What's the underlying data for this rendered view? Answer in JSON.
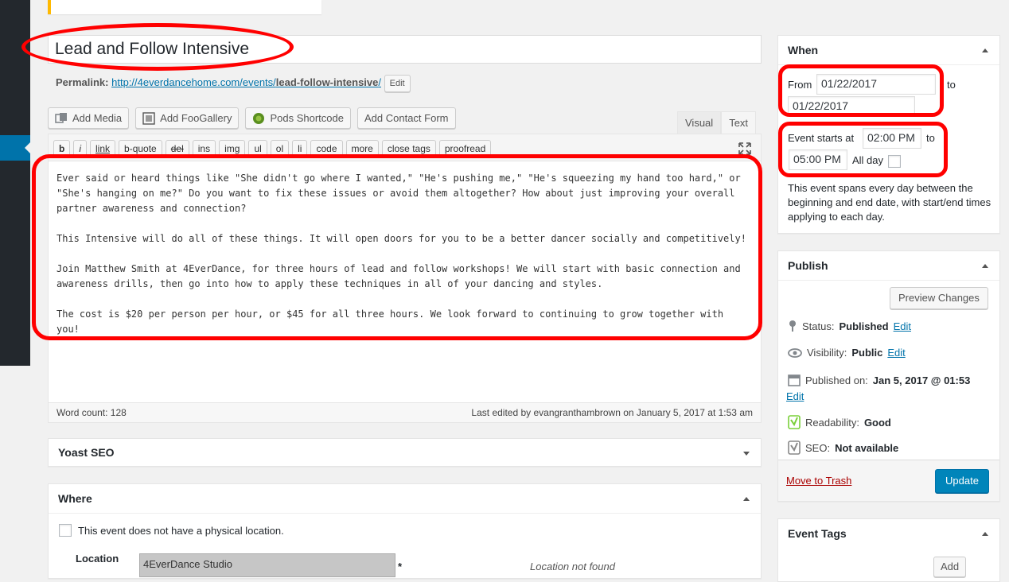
{
  "post": {
    "title": "Lead and Follow Intensive",
    "permalink_label": "Permalink:",
    "permalink_url": "http://4everdancehome.com/events/",
    "permalink_slug": "lead-follow-intensive",
    "permalink_tail": "/",
    "permalink_edit": "Edit"
  },
  "media_buttons": {
    "add_media": "Add Media",
    "add_foogallery": "Add FooGallery",
    "pods_shortcode": "Pods Shortcode",
    "add_contact_form": "Add Contact Form"
  },
  "editor_tabs": {
    "visual": "Visual",
    "text": "Text"
  },
  "quicktags": [
    "b",
    "i",
    "link",
    "b-quote",
    "del",
    "ins",
    "img",
    "ul",
    "ol",
    "li",
    "code",
    "more",
    "close tags",
    "proofread"
  ],
  "content": "Ever said or heard things like \"She didn't go where I wanted,\" \"He's pushing me,\" \"He's squeezing my hand too hard,\" or\n\"She's hanging on me?\" Do you want to fix these issues or avoid them altogether? How about just improving your overall\npartner awareness and connection?\n\nThis Intensive will do all of these things. It will open doors for you to be a better dancer socially and competitively!\n\nJoin Matthew Smith at 4EverDance, for three hours of lead and follow workshops! We will start with basic connection and\nawareness drills, then go into how to apply these techniques in all of your dancing and styles.\n\nThe cost is $20 per person per hour, or $45 for all three hours. We look forward to continuing to grow together with you!",
  "status_bar": {
    "word_count": "Word count: 128",
    "last_edited": "Last edited by evangranthambrown on January 5, 2017 at 1:53 am"
  },
  "yoast": {
    "title": "Yoast SEO"
  },
  "where": {
    "title": "Where",
    "no_location_label": "This event does not have a physical location.",
    "location_label": "Location",
    "location_value": "4EverDance Studio",
    "required_mark": "*",
    "location_status": "Location not found"
  },
  "when": {
    "title": "When",
    "from_label": "From",
    "from_date": "01/22/2017",
    "to_label": "to",
    "to_date": "01/22/2017",
    "starts_label": "Event starts at",
    "start_time": "02:00 PM",
    "time_to_label": "to",
    "end_time": "05:00 PM",
    "all_day_label": "All day",
    "description": "This event spans every day between the beginning and end date, with start/end times applying to each day."
  },
  "publish": {
    "title": "Publish",
    "preview": "Preview Changes",
    "status_label": "Status:",
    "status_value": "Published",
    "visibility_label": "Visibility:",
    "visibility_value": "Public",
    "published_label": "Published on:",
    "published_value": "Jan 5, 2017 @ 01:53",
    "edit": "Edit",
    "readability_label": "Readability:",
    "readability_value": "Good",
    "seo_label": "SEO:",
    "seo_value": "Not available",
    "trash": "Move to Trash",
    "update": "Update"
  },
  "tags": {
    "title": "Event Tags",
    "add": "Add"
  },
  "colors": {
    "highlight": "#ff0000",
    "primary": "#0085ba",
    "accent": "#0073aa"
  }
}
